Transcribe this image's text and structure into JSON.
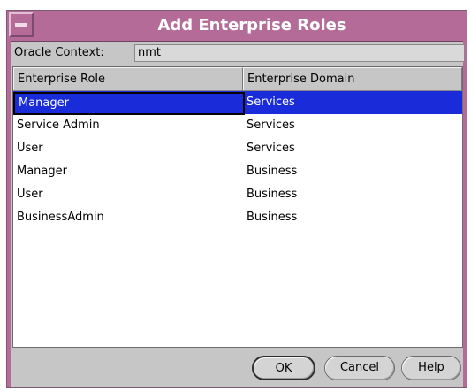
{
  "window": {
    "title": "Add Enterprise Roles"
  },
  "context": {
    "label": "Oracle Context:",
    "value": "nmt"
  },
  "table": {
    "columns": [
      "Enterprise Role",
      "Enterprise Domain"
    ],
    "rows": [
      {
        "role": "Manager",
        "domain": "Services",
        "selected": true
      },
      {
        "role": "Service Admin",
        "domain": "Services",
        "selected": false
      },
      {
        "role": "User",
        "domain": "Services",
        "selected": false
      },
      {
        "role": "Manager",
        "domain": "Business",
        "selected": false
      },
      {
        "role": "User",
        "domain": "Business",
        "selected": false
      },
      {
        "role": "BusinessAdmin",
        "domain": "Business",
        "selected": false
      }
    ]
  },
  "buttons": {
    "ok": "OK",
    "cancel": "Cancel",
    "help": "Help"
  },
  "colors": {
    "title_bar": "#b46b98",
    "selection": "#1a2bd9",
    "background": "#c6c6c6"
  },
  "icons": {
    "window_menu": "window-menu-icon"
  }
}
